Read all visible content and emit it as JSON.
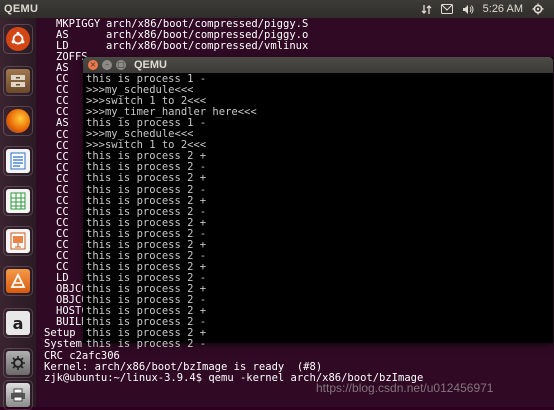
{
  "top_panel": {
    "app_title": "QEMU",
    "clock": "5:26 AM",
    "icons": [
      "network-icon",
      "mail-icon",
      "volume-icon",
      "power-gear-icon"
    ]
  },
  "launcher": {
    "items": [
      {
        "name": "dash-home-icon",
        "color": "#d34615"
      },
      {
        "name": "files-icon",
        "color": "#7a5b3a"
      },
      {
        "name": "firefox-icon",
        "color": "#e66000"
      },
      {
        "name": "writer-icon",
        "color": "#2a6fc9"
      },
      {
        "name": "calc-icon",
        "color": "#2a9a3a"
      },
      {
        "name": "impress-icon",
        "color": "#c85a1a"
      },
      {
        "name": "software-center-icon",
        "color": "#e8762b"
      },
      {
        "name": "amazon-icon",
        "color": "#d9d9d9"
      },
      {
        "name": "system-settings-icon",
        "color": "#8b8b8b"
      }
    ]
  },
  "bg_terminal": {
    "build_lines": [
      {
        "tag": "MKPIGGY",
        "path": "arch/x86/boot/compressed/piggy.S"
      },
      {
        "tag": "AS",
        "path": "arch/x86/boot/compressed/piggy.o"
      },
      {
        "tag": "LD",
        "path": "arch/x86/boot/compressed/vmlinux"
      },
      {
        "tag": "ZOFFS",
        "path": ""
      },
      {
        "tag": "AS",
        "path": ""
      },
      {
        "tag": "CC",
        "path": ""
      },
      {
        "tag": "CC",
        "path": ""
      },
      {
        "tag": "CC",
        "path": ""
      },
      {
        "tag": "CC",
        "path": ""
      },
      {
        "tag": "AS",
        "path": ""
      },
      {
        "tag": "CC",
        "path": ""
      },
      {
        "tag": "CC",
        "path": ""
      },
      {
        "tag": "CC",
        "path": ""
      },
      {
        "tag": "CC",
        "path": ""
      },
      {
        "tag": "CC",
        "path": ""
      },
      {
        "tag": "CC",
        "path": ""
      },
      {
        "tag": "CC",
        "path": ""
      },
      {
        "tag": "CC",
        "path": ""
      },
      {
        "tag": "CC",
        "path": ""
      },
      {
        "tag": "CC",
        "path": ""
      },
      {
        "tag": "CC",
        "path": ""
      },
      {
        "tag": "CC",
        "path": ""
      },
      {
        "tag": "CC",
        "path": ""
      },
      {
        "tag": "LD",
        "path": ""
      },
      {
        "tag": "OBJCO",
        "path": ""
      },
      {
        "tag": "OBJCO",
        "path": ""
      },
      {
        "tag": "HOSTC",
        "path": ""
      },
      {
        "tag": "BUILD",
        "path": ""
      }
    ],
    "tail_lines": [
      "Setup",
      "System",
      "CRC c2afc306",
      "Kernel: arch/x86/boot/bzImage is ready  (#8)",
      "zjk@ubuntu:~/linux-3.9.4$ qemu -kernel arch/x86/boot/bzImage"
    ]
  },
  "qemu_window": {
    "title": "QEMU",
    "lines": [
      "this is process 1 -",
      ">>>my_schedule<<<",
      ">>>switch 1 to 2<<<",
      ">>>my_timer_handler here<<<",
      "this is process 1 -",
      ">>>my_schedule<<<",
      ">>>switch 1 to 2<<<",
      "this is process 2 +",
      "this is process 2 -",
      "this is process 2 +",
      "this is process 2 -",
      "this is process 2 +",
      "this is process 2 -",
      "this is process 2 +",
      "this is process 2 -",
      "this is process 2 +",
      "this is process 2 -",
      "this is process 2 +",
      "this is process 2 -",
      "this is process 2 +",
      "this is process 2 -",
      "this is process 2 +",
      "this is process 2 -",
      "this is process 2 +",
      "this is process 2 -"
    ]
  },
  "watermark": "https://blog.csdn.net/u012456971"
}
